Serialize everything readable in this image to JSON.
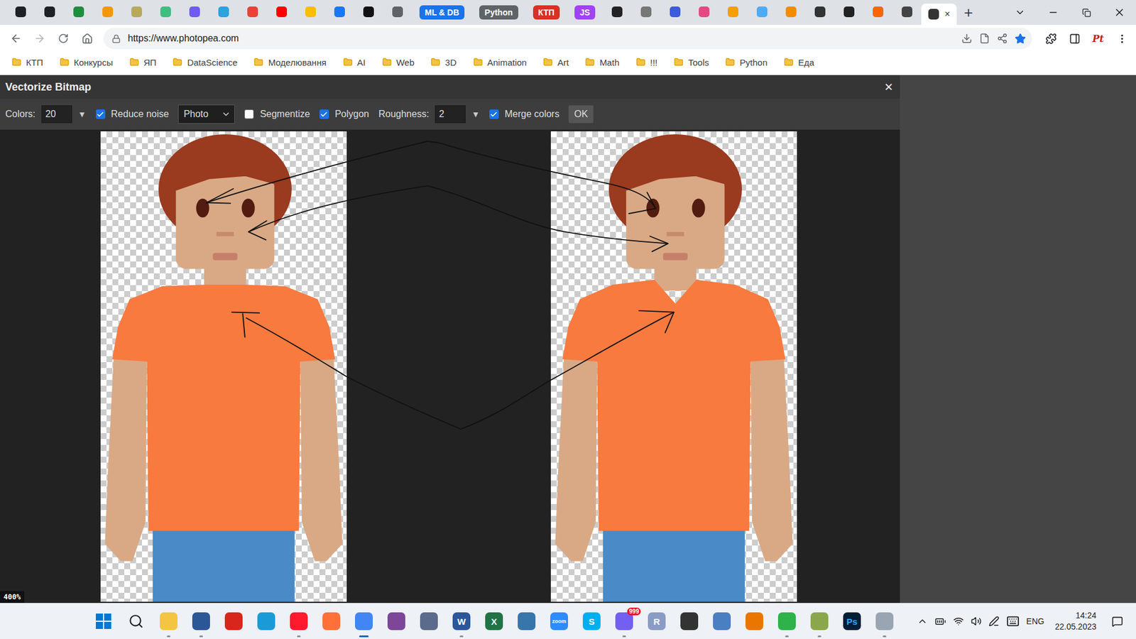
{
  "tabs": [
    {
      "kind": "icon",
      "color": "#202124",
      "selected": false
    },
    {
      "kind": "icon",
      "color": "#202124",
      "selected": false
    },
    {
      "kind": "icon",
      "color": "#1e8e3e",
      "selected": false
    },
    {
      "kind": "icon",
      "color": "#f29900",
      "selected": false
    },
    {
      "kind": "icon",
      "color": "#b9a95a",
      "selected": false
    },
    {
      "kind": "icon",
      "color": "#3fbf7f",
      "selected": false
    },
    {
      "kind": "icon",
      "color": "#6f5cf0",
      "selected": false
    },
    {
      "kind": "icon",
      "color": "#2aa3df",
      "selected": false
    },
    {
      "kind": "icon",
      "color": "#ea4335",
      "selected": false
    },
    {
      "kind": "icon",
      "color": "#ff0000",
      "selected": false
    },
    {
      "kind": "icon",
      "color": "#fbbc04",
      "selected": false
    },
    {
      "kind": "icon",
      "color": "#1877f2",
      "selected": false
    },
    {
      "kind": "icon",
      "color": "#111111",
      "selected": false
    },
    {
      "kind": "icon",
      "color": "#5f6368",
      "selected": false
    },
    {
      "kind": "group",
      "label": "ML & DB",
      "color": "#1a73e8",
      "selected": false
    },
    {
      "kind": "group",
      "label": "Python",
      "color": "#5f6368",
      "selected": false
    },
    {
      "kind": "group",
      "label": "КТП",
      "color": "#d93025",
      "selected": false
    },
    {
      "kind": "group",
      "label": "JS",
      "color": "#a142f4",
      "selected": false
    },
    {
      "kind": "icon",
      "color": "#222222",
      "selected": false
    },
    {
      "kind": "icon",
      "color": "#777777",
      "selected": false
    },
    {
      "kind": "icon",
      "color": "#3b5bdb",
      "selected": false
    },
    {
      "kind": "icon",
      "color": "#e64980",
      "selected": false
    },
    {
      "kind": "icon",
      "color": "#f59f00",
      "selected": false
    },
    {
      "kind": "icon",
      "color": "#4dabf7",
      "selected": false
    },
    {
      "kind": "icon",
      "color": "#f08c00",
      "selected": false
    },
    {
      "kind": "icon",
      "color": "#333333",
      "selected": false
    },
    {
      "kind": "icon",
      "color": "#222222",
      "selected": false
    },
    {
      "kind": "icon",
      "color": "#f76707",
      "selected": false
    },
    {
      "kind": "icon",
      "color": "#444444",
      "selected": false
    },
    {
      "kind": "active",
      "color": "#333333",
      "close": "×",
      "selected": true
    }
  ],
  "new_tab": "+",
  "address": {
    "url": "https://www.photopea.com",
    "bookmarked": true
  },
  "profile": "Pt",
  "bookmarks": [
    "КТП",
    "Конкурсы",
    "ЯП",
    "DataScience",
    "Моделювання",
    "AI",
    "Web",
    "3D",
    "Animation",
    "Art",
    "Math",
    "!!!",
    "Tools",
    "Python",
    "Еда"
  ],
  "dialog": {
    "title": "Vectorize Bitmap",
    "close": "×",
    "controls": [
      {
        "kind": "field",
        "label": "Colors:",
        "value": "20",
        "arrow": "▼"
      },
      {
        "kind": "checkbox",
        "label": "Reduce noise",
        "checked": true
      },
      {
        "kind": "select",
        "value": "Photo"
      },
      {
        "kind": "checkbox",
        "label": "Segmentize",
        "checked": false
      },
      {
        "kind": "checkbox",
        "label": "Polygon",
        "checked": true
      },
      {
        "kind": "field",
        "label": "Roughness:",
        "value": "2",
        "arrow": "▼"
      },
      {
        "kind": "checkbox",
        "label": "Merge colors",
        "checked": true
      },
      {
        "kind": "button",
        "label": "OK"
      }
    ],
    "zoom": "400%"
  },
  "taskbar": {
    "apps": [
      {
        "kind": "windows",
        "color": "#0078d4",
        "running": false,
        "active": false
      },
      {
        "kind": "search",
        "color": "#202124",
        "running": false,
        "active": false
      },
      {
        "kind": "app",
        "color": "#f4c542",
        "running": true,
        "active": false
      },
      {
        "kind": "app",
        "color": "#2b5797",
        "running": true,
        "active": false
      },
      {
        "kind": "app",
        "color": "#d9261c",
        "running": false,
        "active": false
      },
      {
        "kind": "app",
        "color": "#1a9bd7",
        "running": false,
        "active": false
      },
      {
        "kind": "app",
        "color": "#ff1b2d",
        "running": true,
        "active": false
      },
      {
        "kind": "app",
        "color": "#ff7139",
        "running": false,
        "active": false
      },
      {
        "kind": "app",
        "color": "#4285f4",
        "running": true,
        "active": true
      },
      {
        "kind": "app",
        "color": "#7d4698",
        "running": false,
        "active": false
      },
      {
        "kind": "app",
        "color": "#5a6b8c",
        "running": false,
        "active": false
      },
      {
        "kind": "app",
        "color": "#2b579a",
        "glyph": "W",
        "running": true,
        "active": false
      },
      {
        "kind": "app",
        "color": "#217346",
        "glyph": "X",
        "running": false,
        "active": false
      },
      {
        "kind": "app",
        "color": "#3776ab",
        "running": false,
        "active": false
      },
      {
        "kind": "app",
        "color": "#2d8cff",
        "glyph": "zoom",
        "running": false,
        "active": false
      },
      {
        "kind": "app",
        "color": "#00aff0",
        "glyph": "S",
        "running": false,
        "active": false
      },
      {
        "kind": "app",
        "color": "#7360f2",
        "badge": "999",
        "running": true,
        "active": false
      },
      {
        "kind": "app",
        "color": "#8a9cc4",
        "glyph": "R",
        "running": false,
        "active": false
      },
      {
        "kind": "app",
        "color": "#333333",
        "running": false,
        "active": false
      },
      {
        "kind": "app",
        "color": "#4a7fc1",
        "running": false,
        "active": false
      },
      {
        "kind": "app",
        "color": "#ea7600",
        "running": false,
        "active": false
      },
      {
        "kind": "app",
        "color": "#2db34a",
        "running": true,
        "active": false
      },
      {
        "kind": "app",
        "color": "#8aa84b",
        "running": true,
        "active": false
      },
      {
        "kind": "app",
        "color": "#001e36",
        "glyph": "Ps",
        "running": false,
        "active": false
      },
      {
        "kind": "app",
        "color": "#9aa5b4",
        "running": true,
        "active": false
      }
    ],
    "tray": {
      "language": "ENG",
      "time": "14:24",
      "date": "22.05.2023"
    }
  }
}
